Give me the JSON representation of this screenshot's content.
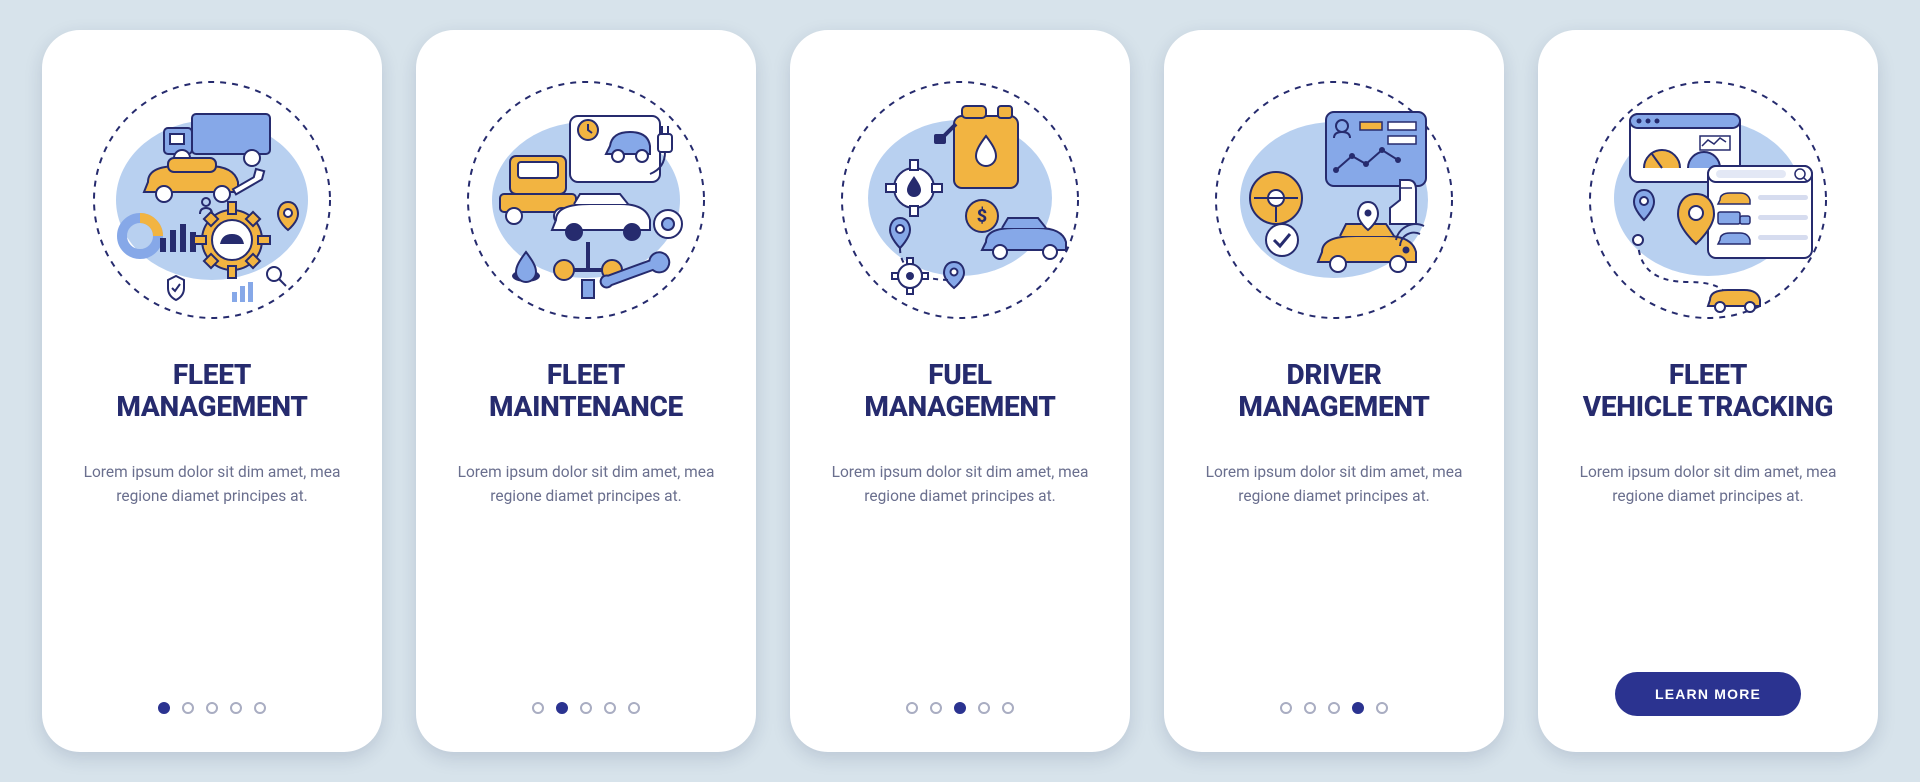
{
  "palette": {
    "navy": "#262b6e",
    "blue": "#86a8e8",
    "lightblue": "#b8d0f0",
    "orange": "#f2b441",
    "white": "#ffffff",
    "bg": "#d7e3eb",
    "button": "#2b3390"
  },
  "cta_label": "LEARN MORE",
  "description_shared": "Lorem ipsum dolor sit dim amet, mea regione diamet principes at.",
  "slides": [
    {
      "title": "FLEET\nMANAGEMENT",
      "icon": "fleet-management-icon",
      "active_index": 0
    },
    {
      "title": "FLEET\nMAINTENANCE",
      "icon": "fleet-maintenance-icon",
      "active_index": 1
    },
    {
      "title": "FUEL\nMANAGEMENT",
      "icon": "fuel-management-icon",
      "active_index": 2
    },
    {
      "title": "DRIVER\nMANAGEMENT",
      "icon": "driver-management-icon",
      "active_index": 3
    },
    {
      "title": "FLEET\nVEHICLE TRACKING",
      "icon": "fleet-tracking-icon",
      "active_index": 4
    }
  ],
  "dot_count": 5
}
